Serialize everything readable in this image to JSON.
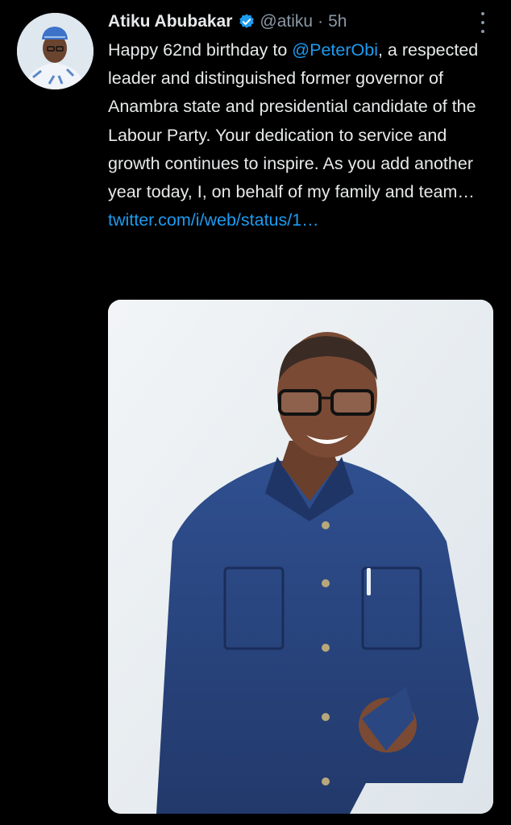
{
  "tweet": {
    "author_name": "Atiku Abubakar",
    "handle": "@atiku",
    "separator": "·",
    "time": "5h",
    "text_before_mention": "Happy 62nd birthday to ",
    "mention": "@PeterObi",
    "text_after_mention": ", a respected leader and distinguished former governor of Anambra state and presidential candidate of the Labour Party. Your dedication to service and growth continues to inspire. As you add another year today, I, on behalf of my family and team… ",
    "link": "twitter.com/i/web/status/1…"
  },
  "colors": {
    "background": "#000000",
    "text": "#e7e9ea",
    "secondary": "#8b98a5",
    "link": "#1d9bf0",
    "verified": "#1d9bf0",
    "shirt": "#2a4782"
  },
  "icons": {
    "verified": "verified-badge-icon",
    "more": "more-options-icon"
  }
}
